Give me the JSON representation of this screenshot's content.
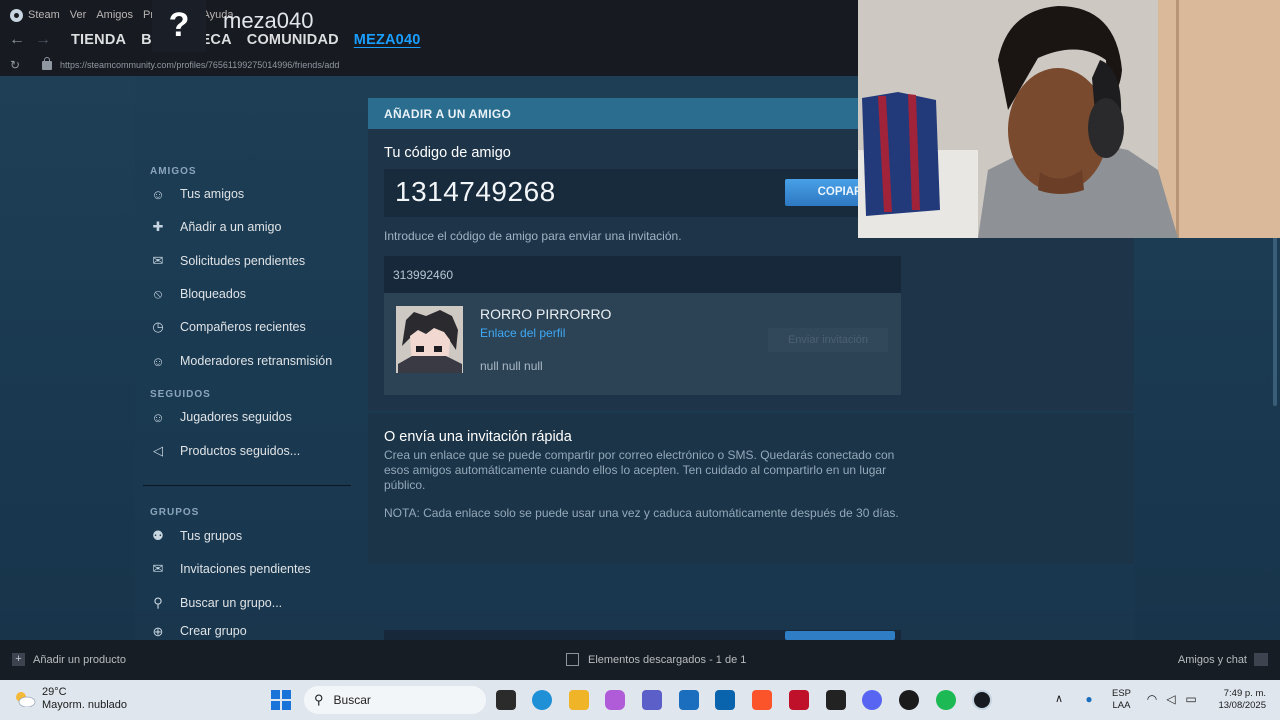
{
  "menubar": {
    "items": [
      "Steam",
      "Ver",
      "Amigos",
      "Productos",
      "Ayuda"
    ]
  },
  "nav": {
    "links": [
      "TIENDA",
      "BIBLIOTECA",
      "COMUNIDAD",
      "MEZA040"
    ],
    "active": "MEZA040"
  },
  "url": "https://steamcommunity.com/profiles/76561199275014996/friends/add",
  "profile": {
    "avatar_glyph": "?",
    "name": "meza040"
  },
  "sidebar": {
    "amigos_title": "AMIGOS",
    "amigos": [
      "Tus amigos",
      "Añadir a un amigo",
      "Solicitudes pendientes",
      "Bloqueados",
      "Compañeros recientes",
      "Moderadores retransmisión"
    ],
    "seguidos_title": "SEGUIDOS",
    "seguidos": [
      "Jugadores seguidos",
      "Productos seguidos..."
    ],
    "grupos_title": "GRUPOS",
    "grupos": [
      "Tus grupos",
      "Invitaciones pendientes",
      "Buscar un grupo...",
      "Crear grupo"
    ]
  },
  "add_friend": {
    "header": "AÑADIR A UN AMIGO",
    "code_title": "Tu código de amigo",
    "code": "1314749268",
    "copy_label": "COPIAR",
    "hint": "Introduce el código de amigo para enviar una invitación.",
    "input_value": "313992460",
    "result": {
      "name": "RORRO PIRRORRO",
      "link": "Enlace del perfil",
      "info": "null null null",
      "send_label": "Enviar invitación"
    }
  },
  "quick_invite": {
    "title": "O envía una invitación rápida",
    "desc": "Crea un enlace que se puede compartir por correo electrónico o SMS. Quedarás conectado con esos amigos automáticamente cuando ellos lo acepten. Ten cuidado al compartirlo en un lugar público.",
    "note": "NOTA: Cada enlace solo se puede usar una vez y caduca automáticamente después de 30 días."
  },
  "bottombar": {
    "add_product": "Añadir un producto",
    "downloads": "Elementos descargados - 1 de 1",
    "friends_chat": "Amigos y chat"
  },
  "taskbar": {
    "temp": "29°C",
    "weather": "Mayorm. nublado",
    "search_placeholder": "Buscar",
    "lang_top": "ESP",
    "lang_bottom": "LAA",
    "time": "7:49 p. m.",
    "date": "13/08/2025"
  }
}
